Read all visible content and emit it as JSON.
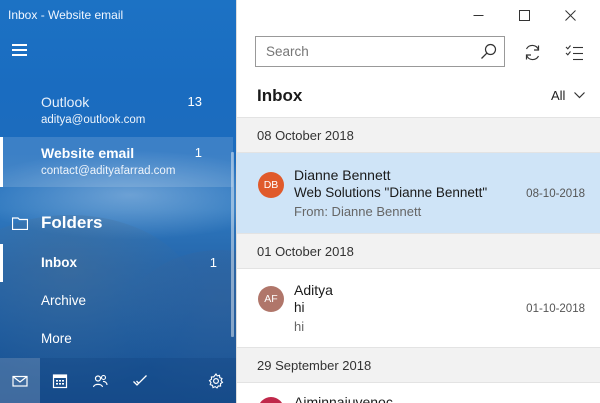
{
  "window": {
    "title": "Inbox - Website email"
  },
  "accounts": [
    {
      "name": "Outlook",
      "email": "aditya@outlook.com",
      "count": "13"
    },
    {
      "name": "Website email",
      "email": "contact@adityafarrad.com",
      "count": "1"
    }
  ],
  "folders": {
    "heading": "Folders",
    "items": [
      {
        "label": "Inbox",
        "count": "1"
      },
      {
        "label": "Archive"
      },
      {
        "label": "More"
      }
    ]
  },
  "bottom_bar": {
    "icons": [
      "mail-icon",
      "calendar-icon",
      "people-icon",
      "todo-icon",
      "settings-icon"
    ]
  },
  "toolbar": {
    "search_placeholder": "Search"
  },
  "list": {
    "title": "Inbox",
    "filter": "All",
    "groups": [
      {
        "date": "08 October 2018",
        "messages": [
          {
            "initials": "DB",
            "avatar_color": "#e05a2b",
            "sender": "Dianne Bennett",
            "subject": "Web Solutions \"Dianne Bennett\"",
            "preview": "From: Dianne Bennett",
            "date": "08-10-2018",
            "selected": true
          }
        ]
      },
      {
        "date": "01 October 2018",
        "messages": [
          {
            "initials": "AF",
            "avatar_color": "#b0766a",
            "sender": "Aditya",
            "subject": "hi",
            "preview": "hi",
            "date": "01-10-2018"
          }
        ]
      },
      {
        "date": "29 September 2018",
        "messages": [
          {
            "avatar_color": "#c0284a",
            "sender": "Aiminnaiuvenoc"
          }
        ]
      }
    ]
  },
  "colors": {
    "accent": "#1c72c4",
    "selected_row": "#cfe4f7"
  }
}
